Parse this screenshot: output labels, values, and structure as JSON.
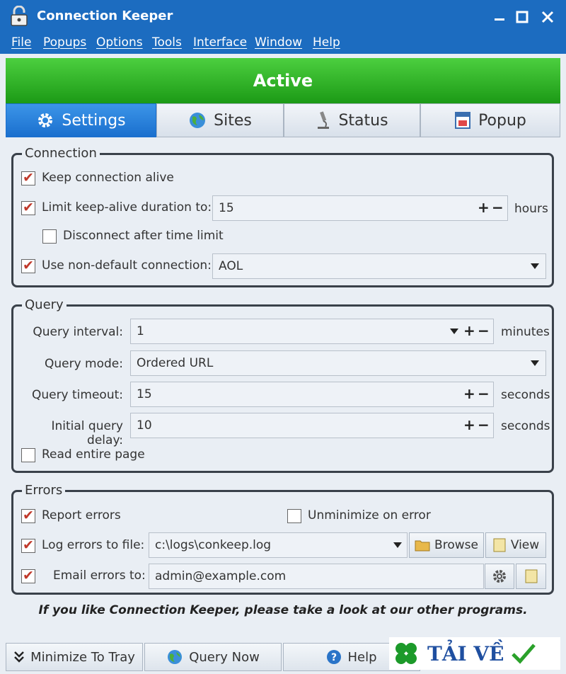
{
  "window": {
    "title": "Connection Keeper",
    "controls": [
      "minimize",
      "maximize",
      "close"
    ]
  },
  "menu": [
    "File",
    "Popups",
    "Options",
    "Tools",
    "Interface",
    "Window",
    "Help"
  ],
  "status_banner": "Active",
  "tabs": [
    {
      "label": "Settings",
      "icon": "gear-icon",
      "selected": true
    },
    {
      "label": "Sites",
      "icon": "globe-icon",
      "selected": false
    },
    {
      "label": "Status",
      "icon": "microscope-icon",
      "selected": false
    },
    {
      "label": "Popup",
      "icon": "popup-window-icon",
      "selected": false
    }
  ],
  "connection": {
    "group_label": "Connection",
    "keep_alive": {
      "label": "Keep connection alive",
      "checked": true
    },
    "limit_duration": {
      "label": "Limit keep-alive duration to:",
      "checked": true,
      "value": "15",
      "unit": "hours"
    },
    "disconnect_after": {
      "label": "Disconnect after time limit",
      "checked": false
    },
    "non_default": {
      "label": "Use non-default connection:",
      "checked": true,
      "value": "AOL"
    }
  },
  "query": {
    "group_label": "Query",
    "interval": {
      "label": "Query interval:",
      "value": "1",
      "unit": "minutes"
    },
    "mode": {
      "label": "Query mode:",
      "value": "Ordered URL"
    },
    "timeout": {
      "label": "Query timeout:",
      "value": "15",
      "unit": "seconds"
    },
    "initial_delay": {
      "label": "Initial query delay:",
      "value": "10",
      "unit": "seconds"
    },
    "read_entire_page": {
      "label": "Read entire page",
      "checked": false
    }
  },
  "errors": {
    "group_label": "Errors",
    "report": {
      "label": "Report errors",
      "checked": true
    },
    "unminimize": {
      "label": "Unminimize on error",
      "checked": false
    },
    "log_to_file": {
      "label": "Log errors to file:",
      "checked": true,
      "value": "c:\\logs\\conkeep.log"
    },
    "browse_label": "Browse",
    "view_label": "View",
    "email": {
      "label": "Email errors to:",
      "checked": true,
      "value": "admin@example.com"
    }
  },
  "promo_text": "If you like Connection Keeper, please take a look at our other programs.",
  "bottom_buttons": {
    "minimize": "Minimize To Tray",
    "query_now": "Query Now",
    "help": "Help"
  },
  "watermark_text": "TẢI VỀ",
  "colors": {
    "accent": "#1c6cc0",
    "active_green": "#2fb526",
    "check_red": "#c0392b"
  }
}
